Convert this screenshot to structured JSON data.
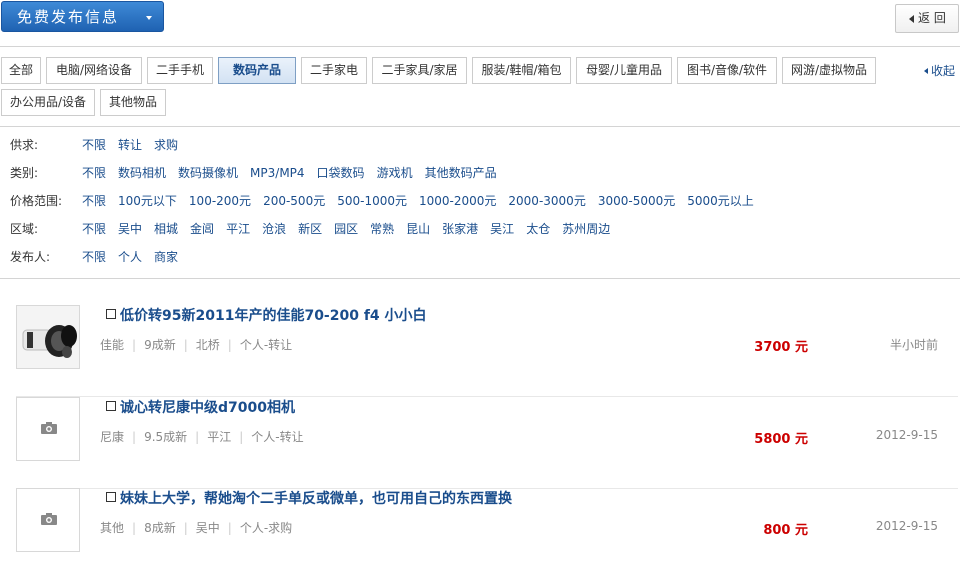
{
  "header": {
    "publish_label": "免费发布信息",
    "back_label": "返 回"
  },
  "categories": [
    {
      "label": "全部"
    },
    {
      "label": "电脑/网络设备"
    },
    {
      "label": "二手手机"
    },
    {
      "label": "数码产品",
      "active": true
    },
    {
      "label": "二手家电"
    },
    {
      "label": "二手家具/家居"
    },
    {
      "label": "服装/鞋帽/箱包"
    },
    {
      "label": "母婴/儿童用品"
    },
    {
      "label": "图书/音像/软件"
    },
    {
      "label": "网游/虚拟物品"
    },
    {
      "label": "办公用品/设备"
    },
    {
      "label": "其他物品"
    }
  ],
  "collapse_label": "收起",
  "filters": [
    {
      "label": "供求:",
      "options": [
        "不限",
        "转让",
        "求购"
      ]
    },
    {
      "label": "类别:",
      "options": [
        "不限",
        "数码相机",
        "数码摄像机",
        "MP3/MP4",
        "口袋数码",
        "游戏机",
        "其他数码产品"
      ]
    },
    {
      "label": "价格范围:",
      "options": [
        "不限",
        "100元以下",
        "100-200元",
        "200-500元",
        "500-1000元",
        "1000-2000元",
        "2000-3000元",
        "3000-5000元",
        "5000元以上"
      ]
    },
    {
      "label": "区域:",
      "options": [
        "不限",
        "吴中",
        "相城",
        "金阊",
        "平江",
        "沧浪",
        "新区",
        "园区",
        "常熟",
        "昆山",
        "张家港",
        "吴江",
        "太仓",
        "苏州周边"
      ]
    },
    {
      "label": "发布人:",
      "options": [
        "不限",
        "个人",
        "商家"
      ]
    }
  ],
  "listings": [
    {
      "title": "低价转95新2011年产的佳能70-200 f4 小小白",
      "meta": [
        "佳能",
        "9成新",
        "北桥",
        "个人-转让"
      ],
      "price": "3700 元",
      "time": "半小时前",
      "has_photo": true
    },
    {
      "title": "诚心转尼康中级d7000相机",
      "meta": [
        "尼康",
        "9.5成新",
        "平江",
        "个人-转让"
      ],
      "price": "5800 元",
      "time": "2012-9-15",
      "has_photo": false
    },
    {
      "title": "妹妹上大学，帮她淘个二手单反或微单，也可用自己的东西置换",
      "meta": [
        "其他",
        "8成新",
        "吴中",
        "个人-求购"
      ],
      "price": "800 元",
      "time": "2012-9-15",
      "has_photo": false
    }
  ]
}
